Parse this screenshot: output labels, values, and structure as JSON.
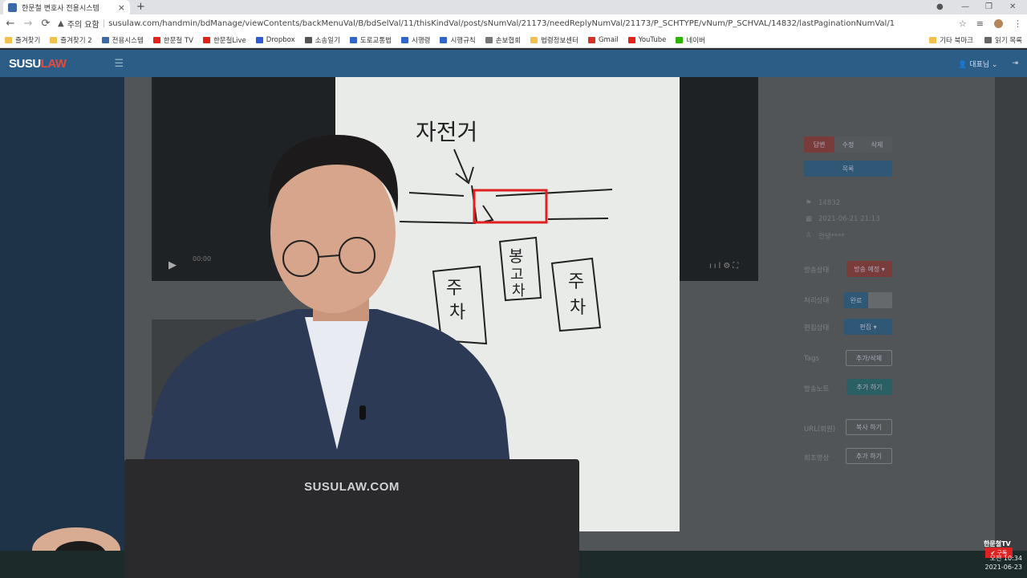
{
  "browser": {
    "tab_title": "한문철 변호사 전용시스템",
    "url_warning": "주의 요함",
    "url": "susulaw.com/handmin/bdManage/viewContents/backMenuVal/B/bdSelVal/11/thisKindVal/post/sNumVal/21173/needReplyNumVal/21173/P_SCHTYPE/vNum/P_SCHVAL/14832/lastPaginationNumVal/1",
    "bookmarks": [
      {
        "label": "즐겨찾기",
        "color": "#f0c24b"
      },
      {
        "label": "즐겨찾기 2",
        "color": "#f0c24b"
      },
      {
        "label": "전용시스템",
        "color": "#3b6aa8"
      },
      {
        "label": "한문철 TV",
        "color": "#e62117"
      },
      {
        "label": "한문철Live",
        "color": "#e62117"
      },
      {
        "label": "Dropbox",
        "color": "#2f5bd8"
      },
      {
        "label": "소송일기",
        "color": "#555555"
      },
      {
        "label": "도로교통법",
        "color": "#3167c9"
      },
      {
        "label": "시행령",
        "color": "#3167c9"
      },
      {
        "label": "시행규칙",
        "color": "#3167c9"
      },
      {
        "label": "손보협회",
        "color": "#777777"
      },
      {
        "label": "법령정보센터",
        "color": "#f0c24b"
      },
      {
        "label": "Gmail",
        "color": "#d93025"
      },
      {
        "label": "YouTube",
        "color": "#e62117"
      },
      {
        "label": "네이버",
        "color": "#2db400"
      }
    ],
    "bookmarks_right": [
      {
        "label": "기타 북마크"
      },
      {
        "label": "읽기 목록"
      }
    ]
  },
  "app": {
    "logo_a": "SUSU",
    "logo_b": "LAW",
    "user_label": "대표님 ⌄"
  },
  "panel": {
    "actions": [
      "답변",
      "수정",
      "삭제"
    ],
    "list_button": "목록",
    "post_no": "14832",
    "date": "2021-06-21 21:13",
    "author": "안녕****",
    "rows": [
      {
        "label": "방송상태",
        "value": "방송 예정 ▾"
      },
      {
        "label": "처리상태",
        "value": "완료"
      },
      {
        "label": "편집상태",
        "value": "편집 ▾"
      },
      {
        "label": "Tags",
        "value": "추가/삭제"
      },
      {
        "label": "방송노트",
        "value": "추가 하기"
      },
      {
        "label": "URL(회원)",
        "value": "복사 하기"
      },
      {
        "label": "회초영상",
        "value": "추가 하기"
      }
    ]
  },
  "video": {
    "time": "00:00"
  },
  "board": {
    "word_bicycle": "자전거",
    "car_left_1": "주",
    "car_left_2": "차",
    "car_mid_1": "봉",
    "car_mid_2": "고",
    "car_mid_3": "차",
    "car_right_1": "주",
    "car_right_2": "차"
  },
  "monitor_brand": "SUSULAW.COM",
  "overlay": {
    "channel": "한문철TV",
    "subscribe": "구독",
    "time": "오전 10:34",
    "date": "2021-06-23"
  }
}
